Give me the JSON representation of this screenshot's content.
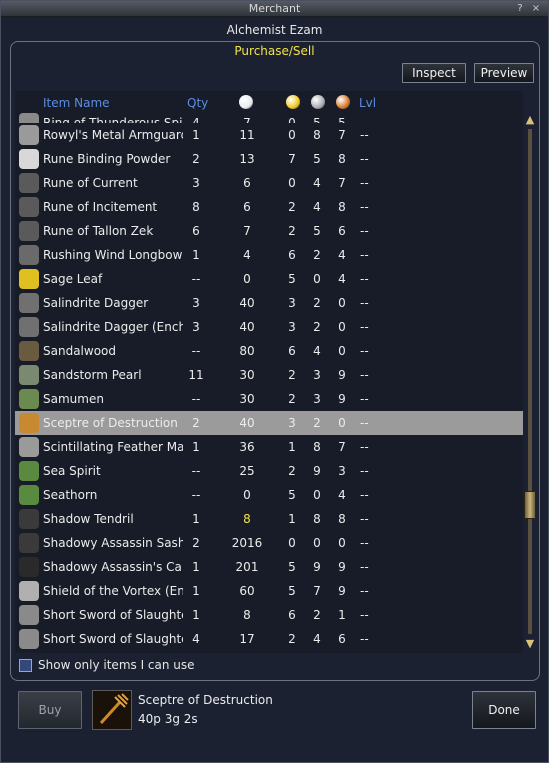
{
  "window": {
    "title": "Merchant",
    "help_glyph": "?",
    "close_glyph": "×"
  },
  "merchant": {
    "name": "Alchemist Ezam",
    "mode": "Purchase/Sell"
  },
  "toolbar": {
    "inspect_label": "Inspect",
    "preview_label": "Preview"
  },
  "columns": {
    "name": "Item Name",
    "qty": "Qty",
    "level": "Lvl"
  },
  "currency_icons": [
    {
      "name": "platinum-coin-icon",
      "color": "#e8ecf2"
    },
    {
      "name": "gold-coin-icon",
      "color": "#f2c81e"
    },
    {
      "name": "silver-coin-icon",
      "color": "#a9adb4"
    },
    {
      "name": "copper-coin-icon",
      "color": "#d6792a"
    }
  ],
  "items": [
    {
      "name": "Ring of Thunderous Spirit",
      "qty": "4",
      "plat": "7",
      "gold": "0",
      "silver": "5",
      "copper": "5",
      "lvl": "--",
      "icon": "ring-icon",
      "icon_color": "#8a8a8a"
    },
    {
      "name": "Rowyl's Metal Armguards",
      "qty": "1",
      "plat": "11",
      "gold": "0",
      "silver": "8",
      "copper": "7",
      "lvl": "--",
      "icon": "armguards-icon",
      "icon_color": "#9a9a9a"
    },
    {
      "name": "Rune Binding Powder",
      "qty": "2",
      "plat": "13",
      "gold": "7",
      "silver": "5",
      "copper": "8",
      "lvl": "--",
      "icon": "powder-icon",
      "icon_color": "#d8d8d8"
    },
    {
      "name": "Rune of Current",
      "qty": "3",
      "plat": "6",
      "gold": "0",
      "silver": "4",
      "copper": "7",
      "lvl": "--",
      "icon": "rune-icon",
      "icon_color": "#5a5a5a"
    },
    {
      "name": "Rune of Incitement",
      "qty": "8",
      "plat": "6",
      "gold": "2",
      "silver": "4",
      "copper": "8",
      "lvl": "--",
      "icon": "rune-icon",
      "icon_color": "#5a5a5a"
    },
    {
      "name": "Rune of Tallon Zek",
      "qty": "6",
      "plat": "7",
      "gold": "2",
      "silver": "5",
      "copper": "6",
      "lvl": "--",
      "icon": "rune-icon",
      "icon_color": "#5a5a5a"
    },
    {
      "name": "Rushing Wind Longbow",
      "qty": "1",
      "plat": "4",
      "gold": "6",
      "silver": "2",
      "copper": "4",
      "lvl": "--",
      "icon": "bow-icon",
      "icon_color": "#6a6a6a"
    },
    {
      "name": "Sage Leaf",
      "qty": "--",
      "plat": "0",
      "gold": "5",
      "silver": "0",
      "copper": "4",
      "lvl": "--",
      "icon": "leaf-icon",
      "icon_color": "#e0c020"
    },
    {
      "name": "Salindrite Dagger",
      "qty": "3",
      "plat": "40",
      "gold": "3",
      "silver": "2",
      "copper": "0",
      "lvl": "--",
      "icon": "dagger-icon",
      "icon_color": "#707070"
    },
    {
      "name": "Salindrite Dagger (Encha",
      "qty": "3",
      "plat": "40",
      "gold": "3",
      "silver": "2",
      "copper": "0",
      "lvl": "--",
      "icon": "dagger-icon",
      "icon_color": "#707070"
    },
    {
      "name": "Sandalwood",
      "qty": "--",
      "plat": "80",
      "gold": "6",
      "silver": "4",
      "copper": "0",
      "lvl": "--",
      "icon": "wood-icon",
      "icon_color": "#6a5a40"
    },
    {
      "name": "Sandstorm Pearl",
      "qty": "11",
      "plat": "30",
      "gold": "2",
      "silver": "3",
      "copper": "9",
      "lvl": "--",
      "icon": "pearl-icon",
      "icon_color": "#7a8a70"
    },
    {
      "name": "Samumen",
      "qty": "--",
      "plat": "30",
      "gold": "2",
      "silver": "3",
      "copper": "9",
      "lvl": "--",
      "icon": "herb-icon",
      "icon_color": "#6a8a50"
    },
    {
      "name": "Sceptre of Destruction",
      "qty": "2",
      "plat": "40",
      "gold": "3",
      "silver": "2",
      "copper": "0",
      "lvl": "--",
      "icon": "sceptre-icon",
      "icon_color": "#c88a30",
      "selected": true
    },
    {
      "name": "Scintillating Feather Mas",
      "qty": "1",
      "plat": "36",
      "gold": "1",
      "silver": "8",
      "copper": "7",
      "lvl": "--",
      "icon": "mask-icon",
      "icon_color": "#9a9a9a"
    },
    {
      "name": "Sea Spirit",
      "qty": "--",
      "plat": "25",
      "gold": "2",
      "silver": "9",
      "copper": "3",
      "lvl": "--",
      "icon": "herb-icon",
      "icon_color": "#5a8a40"
    },
    {
      "name": "Seathorn",
      "qty": "--",
      "plat": "0",
      "gold": "5",
      "silver": "0",
      "copper": "4",
      "lvl": "--",
      "icon": "herb-icon",
      "icon_color": "#5a8a40"
    },
    {
      "name": "Shadow Tendril",
      "qty": "1",
      "plat": "8",
      "gold": "1",
      "silver": "8",
      "copper": "8",
      "lvl": "--",
      "icon": "tendril-icon",
      "icon_color": "#3a3a3a",
      "plat_highlight": true
    },
    {
      "name": "Shadowy Assassin Sash",
      "qty": "2",
      "plat": "2016",
      "gold": "0",
      "silver": "0",
      "copper": "0",
      "lvl": "--",
      "icon": "sash-icon",
      "icon_color": "#3a3a3a"
    },
    {
      "name": "Shadowy Assassin's Ca",
      "qty": "1",
      "plat": "201",
      "gold": "5",
      "silver": "9",
      "copper": "9",
      "lvl": "--",
      "icon": "cloak-icon",
      "icon_color": "#2a2a2a"
    },
    {
      "name": "Shield of the Vortex (Ench",
      "qty": "1",
      "plat": "60",
      "gold": "5",
      "silver": "7",
      "copper": "9",
      "lvl": "--",
      "icon": "shield-icon",
      "icon_color": "#b0b0b0"
    },
    {
      "name": "Short Sword of Slaughter",
      "qty": "1",
      "plat": "8",
      "gold": "6",
      "silver": "2",
      "copper": "1",
      "lvl": "--",
      "icon": "sword-icon",
      "icon_color": "#8a8a8a"
    },
    {
      "name": "Short Sword of Slaughter",
      "qty": "4",
      "plat": "17",
      "gold": "2",
      "silver": "4",
      "copper": "6",
      "lvl": "--",
      "icon": "sword-icon",
      "icon_color": "#8a8a8a"
    }
  ],
  "filter": {
    "label": "Show only items I can use"
  },
  "footer": {
    "buy_label": "Buy",
    "done_label": "Done",
    "selected_item_name": "Sceptre of Destruction",
    "selected_item_price": "40p 3g 2s"
  }
}
